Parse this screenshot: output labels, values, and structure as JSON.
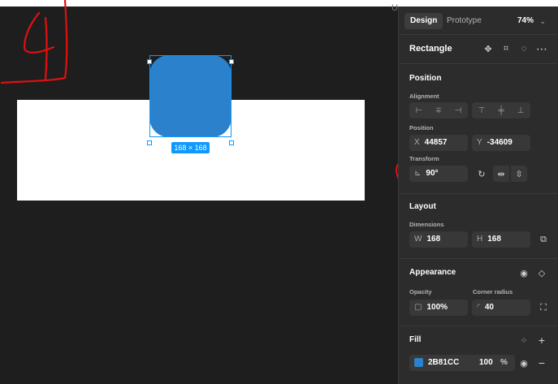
{
  "canvas": {
    "handwritten_note": "4",
    "edge_glyph": "U",
    "selection": {
      "size_label": "168 × 168",
      "fill_color": "#2B81CC",
      "frame_color": "#FFFFFF"
    }
  },
  "panel": {
    "tabs": [
      {
        "label": "Design",
        "active": true
      },
      {
        "label": "Prototype",
        "active": false
      }
    ],
    "zoom": "74%",
    "layer_name": "Rectangle",
    "position": {
      "title": "Position",
      "alignment_label": "Alignment",
      "position_label": "Position",
      "x_prefix": "X",
      "x_value": "44857",
      "y_prefix": "Y",
      "y_value": "-34609",
      "transform_label": "Transform",
      "rotation_value": "90°"
    },
    "layout": {
      "title": "Layout",
      "dimensions_label": "Dimensions",
      "w_prefix": "W",
      "w_value": "168",
      "h_prefix": "H",
      "h_value": "168"
    },
    "appearance": {
      "title": "Appearance",
      "opacity_label": "Opacity",
      "opacity_value": "100%",
      "corner_label": "Corner radius",
      "corner_value": "40"
    },
    "fill": {
      "title": "Fill",
      "hex": "2B81CC",
      "opacity": "100",
      "unit": "%",
      "color": "#2B81CC"
    }
  }
}
